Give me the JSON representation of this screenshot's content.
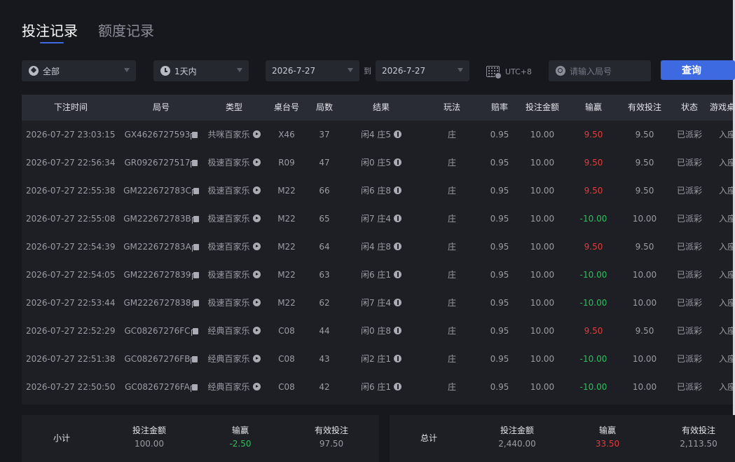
{
  "tabs": [
    {
      "label": "投注记录",
      "active": true
    },
    {
      "label": "额度记录",
      "active": false
    }
  ],
  "filters": {
    "game": "全部",
    "range": "1天内",
    "start_date": "2026-7-27",
    "to": "到",
    "end_date": "2026-7-27",
    "timezone": "UTC+8",
    "round_placeholder": "请输入局号",
    "query_label": "查询"
  },
  "table": {
    "headers": [
      "下注时间",
      "局号",
      "类型",
      "桌台号",
      "局数",
      "结果",
      "玩法",
      "赔率",
      "投注金额",
      "输赢",
      "有效投注",
      "状态",
      "游戏桌"
    ],
    "rows": [
      {
        "time": "2026-07-27 23:03:15",
        "round": "GX4626727593",
        "type": "共咪百家乐",
        "table": "X46",
        "shoe": "37",
        "result": "闲4 庄5",
        "bet": "庄",
        "odds": "0.95",
        "amount": "10.00",
        "winloss": "9.50",
        "outcome": "win",
        "valid": "9.50",
        "status": "已派彩",
        "game_table": "入座"
      },
      {
        "time": "2026-07-27 22:56:34",
        "round": "GR0926727517",
        "type": "极速百家乐",
        "table": "R09",
        "shoe": "47",
        "result": "闲0 庄5",
        "bet": "庄",
        "odds": "0.95",
        "amount": "10.00",
        "winloss": "9.50",
        "outcome": "win",
        "valid": "9.50",
        "status": "已派彩",
        "game_table": "入座"
      },
      {
        "time": "2026-07-27 22:55:38",
        "round": "GM222672783C",
        "type": "极速百家乐",
        "table": "M22",
        "shoe": "66",
        "result": "闲6 庄8",
        "bet": "庄",
        "odds": "0.95",
        "amount": "10.00",
        "winloss": "9.50",
        "outcome": "win",
        "valid": "9.50",
        "status": "已派彩",
        "game_table": "入座"
      },
      {
        "time": "2026-07-27 22:55:08",
        "round": "GM222672783B",
        "type": "极速百家乐",
        "table": "M22",
        "shoe": "65",
        "result": "闲7 庄4",
        "bet": "庄",
        "odds": "0.95",
        "amount": "10.00",
        "winloss": "-10.00",
        "outcome": "loss",
        "valid": "10.00",
        "status": "已派彩",
        "game_table": "入座"
      },
      {
        "time": "2026-07-27 22:54:39",
        "round": "GM222672783A",
        "type": "极速百家乐",
        "table": "M22",
        "shoe": "64",
        "result": "闲4 庄8",
        "bet": "庄",
        "odds": "0.95",
        "amount": "10.00",
        "winloss": "9.50",
        "outcome": "win",
        "valid": "9.50",
        "status": "已派彩",
        "game_table": "入座"
      },
      {
        "time": "2026-07-27 22:54:05",
        "round": "GM2226727839",
        "type": "极速百家乐",
        "table": "M22",
        "shoe": "63",
        "result": "闲6 庄1",
        "bet": "庄",
        "odds": "0.95",
        "amount": "10.00",
        "winloss": "-10.00",
        "outcome": "loss",
        "valid": "10.00",
        "status": "已派彩",
        "game_table": "入座"
      },
      {
        "time": "2026-07-27 22:53:44",
        "round": "GM2226727838",
        "type": "极速百家乐",
        "table": "M22",
        "shoe": "62",
        "result": "闲7 庄4",
        "bet": "庄",
        "odds": "0.95",
        "amount": "10.00",
        "winloss": "-10.00",
        "outcome": "loss",
        "valid": "10.00",
        "status": "已派彩",
        "game_table": "入座"
      },
      {
        "time": "2026-07-27 22:52:29",
        "round": "GC08267276FC",
        "type": "经典百家乐",
        "table": "C08",
        "shoe": "44",
        "result": "闲0 庄8",
        "bet": "庄",
        "odds": "0.95",
        "amount": "10.00",
        "winloss": "9.50",
        "outcome": "win",
        "valid": "9.50",
        "status": "已派彩",
        "game_table": "入座"
      },
      {
        "time": "2026-07-27 22:51:38",
        "round": "GC08267276FB",
        "type": "经典百家乐",
        "table": "C08",
        "shoe": "43",
        "result": "闲2 庄1",
        "bet": "庄",
        "odds": "0.95",
        "amount": "10.00",
        "winloss": "-10.00",
        "outcome": "loss",
        "valid": "10.00",
        "status": "已派彩",
        "game_table": "入座"
      },
      {
        "time": "2026-07-27 22:50:50",
        "round": "GC08267276FA",
        "type": "经典百家乐",
        "table": "C08",
        "shoe": "42",
        "result": "闲6 庄1",
        "bet": "庄",
        "odds": "0.95",
        "amount": "10.00",
        "winloss": "-10.00",
        "outcome": "loss",
        "valid": "10.00",
        "status": "已派彩",
        "game_table": "入座"
      }
    ]
  },
  "subtotal": {
    "title": "小计",
    "amount_label": "投注金额",
    "amount": "100.00",
    "winloss_label": "输赢",
    "winloss": "-2.50",
    "winloss_outcome": "loss",
    "valid_label": "有效投注",
    "valid": "97.50"
  },
  "total": {
    "title": "总计",
    "amount_label": "投注金额",
    "amount": "2,440.00",
    "winloss_label": "输赢",
    "winloss": "33.50",
    "winloss_outcome": "win",
    "valid_label": "有效投注",
    "valid": "2,113.50"
  },
  "colors": {
    "accent": "#3e6ae1",
    "win": "#e23c3c",
    "loss": "#2fbf5f"
  },
  "icons": {
    "game_filter": "spade-icon",
    "range_filter": "clock-icon",
    "timezone": "calendar-icon",
    "round_search": "search-icon",
    "copy": "copy-icon",
    "play": "play-icon",
    "info": "info-icon"
  }
}
